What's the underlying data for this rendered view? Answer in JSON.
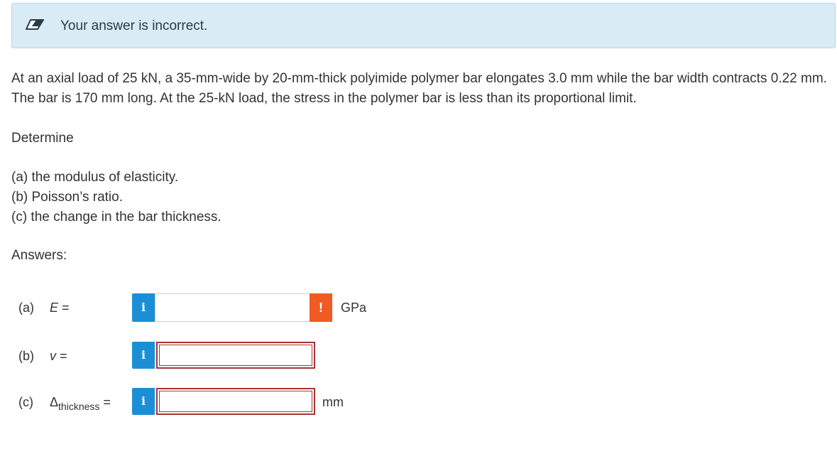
{
  "banner": {
    "message": "Your answer is incorrect.",
    "icon": "pencil-eraser-icon"
  },
  "problem": {
    "text": "At an axial load of 25 kN, a 35-mm-wide by 20-mm-thick polyimide polymer bar elongates 3.0 mm while the bar width contracts 0.22 mm. The bar is 170 mm long. At the 25-kN load, the stress in the polymer bar is less than its proportional limit.",
    "determine": "Determine",
    "parts": [
      "(a) the modulus of elasticity.",
      "(b) Poisson’s ratio.",
      "(c) the change in the bar thickness."
    ],
    "answers_label": "Answers:"
  },
  "answers": [
    {
      "part": "(a)",
      "variable": "E",
      "equals": "=",
      "value": "",
      "unit": "GPa",
      "status": "warning"
    },
    {
      "part": "(b)",
      "variable": "v",
      "equals": "=",
      "value": "",
      "unit": "",
      "status": "incorrect"
    },
    {
      "part": "(c)",
      "variable": "Δ",
      "subscript": "thickness",
      "equals": "=",
      "value": "",
      "unit": "mm",
      "status": "incorrect"
    }
  ],
  "info_button_glyph": "i",
  "warning_glyph": "!",
  "colors": {
    "info_blue": "#1b8fd6",
    "warning_orange": "#f15a22",
    "error_red": "#a83434",
    "banner_bg": "#d9ebf5"
  }
}
